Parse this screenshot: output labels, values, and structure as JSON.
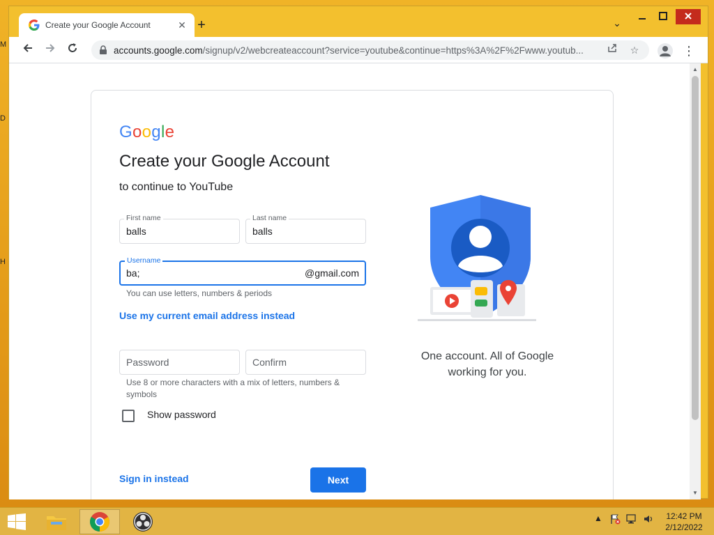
{
  "desktop": {
    "edge_letters": [
      "M",
      "D",
      "H"
    ]
  },
  "browser": {
    "tab_title": "Create your Google Account",
    "new_tab": "+",
    "tab_search": "⌄",
    "minimize": "🗕",
    "maximize": "🗖",
    "close": "✕",
    "url_host": "accounts.google.com",
    "url_path": "/signup/v2/webcreateaccount?service=youtube&continue=https%3A%2F%2Fwww.youtub...",
    "icons": [
      "back-icon",
      "forward-icon",
      "reload-icon",
      "lock-icon",
      "share-icon",
      "star-icon",
      "profile-icon",
      "kebab-menu-icon"
    ]
  },
  "form": {
    "logo": {
      "G": "G",
      "o1": "o",
      "o2": "o",
      "g": "g",
      "l": "l",
      "e": "e"
    },
    "title": "Create your Google Account",
    "subtitle": "to continue to YouTube",
    "first_name_label": "First name",
    "first_name_value": "balls",
    "last_name_label": "Last name",
    "last_name_value": "balls",
    "username_label": "Username",
    "username_value": "ba;",
    "username_suffix": "@gmail.com",
    "username_hint": "You can use letters, numbers & periods",
    "use_email_link": "Use my current email address instead",
    "password_placeholder": "Password",
    "confirm_placeholder": "Confirm",
    "password_hint": "Use 8 or more characters with a mix of letters, numbers & symbols",
    "show_password_label": "Show password",
    "show_password_checked": false,
    "sign_in_link": "Sign in instead",
    "next_button": "Next",
    "tagline_line1": "One account. All of Google",
    "tagline_line2": "working for you.",
    "accent_color": "#1a73e8"
  },
  "taskbar": {
    "apps": [
      "file-explorer-icon",
      "chrome-icon",
      "obs-icon"
    ],
    "active_app": "chrome-icon",
    "time": "12:42 PM",
    "date": "2/12/2022"
  }
}
